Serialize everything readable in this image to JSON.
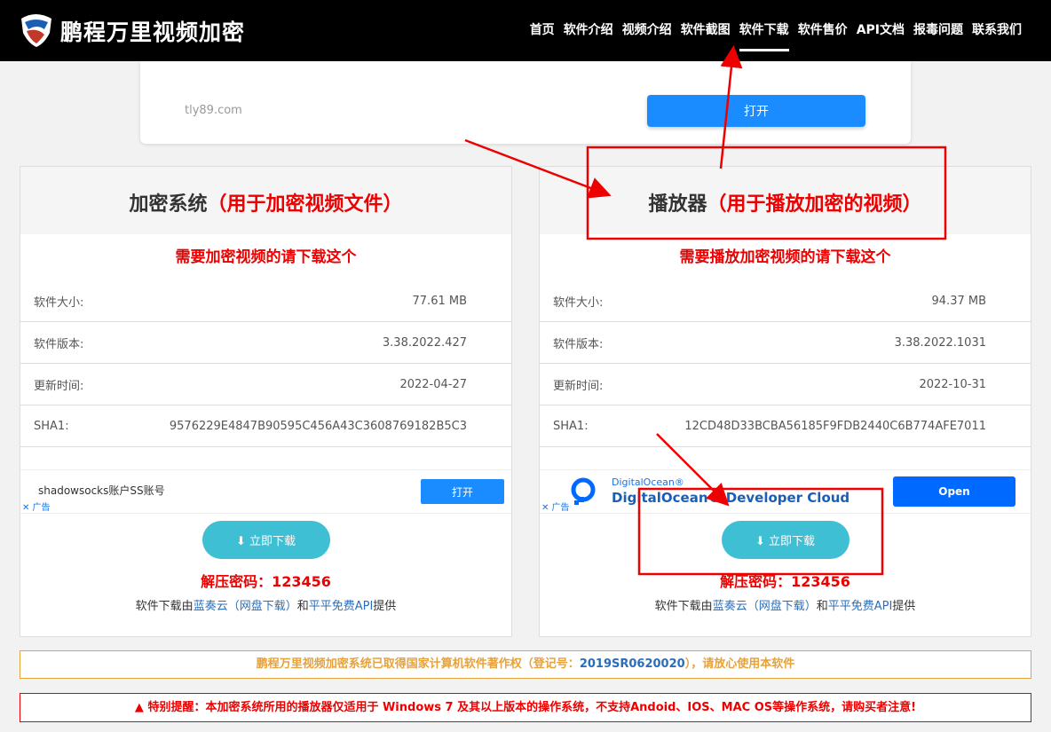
{
  "header": {
    "brand": "鹏程万里视频加密",
    "nav": [
      {
        "label": "首页",
        "active": false
      },
      {
        "label": "软件介绍",
        "active": false
      },
      {
        "label": "视频介绍",
        "active": false
      },
      {
        "label": "软件截图",
        "active": false
      },
      {
        "label": "软件下载",
        "active": true
      },
      {
        "label": "软件售价",
        "active": false
      },
      {
        "label": "API文档",
        "active": false
      },
      {
        "label": "报毒问题",
        "active": false
      },
      {
        "label": "联系我们",
        "active": false
      }
    ]
  },
  "top_ad": {
    "domain": "tly89.com",
    "button": "打开"
  },
  "left_card": {
    "title": "加密系统",
    "title_note": "（用于加密视频文件）",
    "subtitle": "需要加密视频的请下载这个",
    "rows": [
      {
        "label": "软件大小:",
        "value": "77.61 MB"
      },
      {
        "label": "软件版本:",
        "value": "3.38.2022.427"
      },
      {
        "label": "更新时间:",
        "value": "2022-04-27"
      },
      {
        "label": "SHA1:",
        "value": "9576229E4847B90595C456A43C3608769182B5C3"
      }
    ],
    "ad_text": "shadowsocks账户SS账号",
    "ad_button": "打开",
    "ad_mark": "✕ 广告",
    "download": "立即下载",
    "password": "解压密码：123456",
    "provider_prefix": "软件下载由",
    "provider_link1": "蓝奏云（网盘下载）",
    "provider_and": "和",
    "provider_link2": "平平免费API",
    "provider_suffix": "提供"
  },
  "right_card": {
    "title": "播放器",
    "title_note": "（用于播放加密的视频）",
    "subtitle": "需要播放加密视频的请下载这个",
    "rows": [
      {
        "label": "软件大小:",
        "value": "94.37 MB"
      },
      {
        "label": "软件版本:",
        "value": "3.38.2022.1031"
      },
      {
        "label": "更新时间:",
        "value": "2022-10-31"
      },
      {
        "label": "SHA1:",
        "value": "12CD48D33BCBA56185F9FDB2440C6B774AFE7011"
      }
    ],
    "ad_small": "DigitalOcean®",
    "ad_big": "DigitalOcean® Developer Cloud",
    "ad_button": "Open",
    "ad_mark": "✕ 广告",
    "download": "立即下载",
    "password": "解压密码：123456",
    "provider_prefix": "软件下载由",
    "provider_link1": "蓝奏云（网盘下载）",
    "provider_and": "和",
    "provider_link2": "平平免费API",
    "provider_suffix": "提供"
  },
  "notices": {
    "copyright_prefix": "鹏程万里视频加密系统已取得国家计算机软件著作权（登记号：",
    "copyright_reg": "2019SR0620020",
    "copyright_suffix": "），请放心使用本软件",
    "warning": "▲ 特别提醒：本加密系统所用的播放器仅适用于 Windows 7 及其以上版本的操作系统，不支持Andoid、IOS、MAC OS等操作系统，请购买者注意!"
  },
  "colors": {
    "accent": "#1a8cff",
    "download": "#3fbfd3",
    "alert": "#ee0000",
    "gold": "#e6a23c"
  }
}
